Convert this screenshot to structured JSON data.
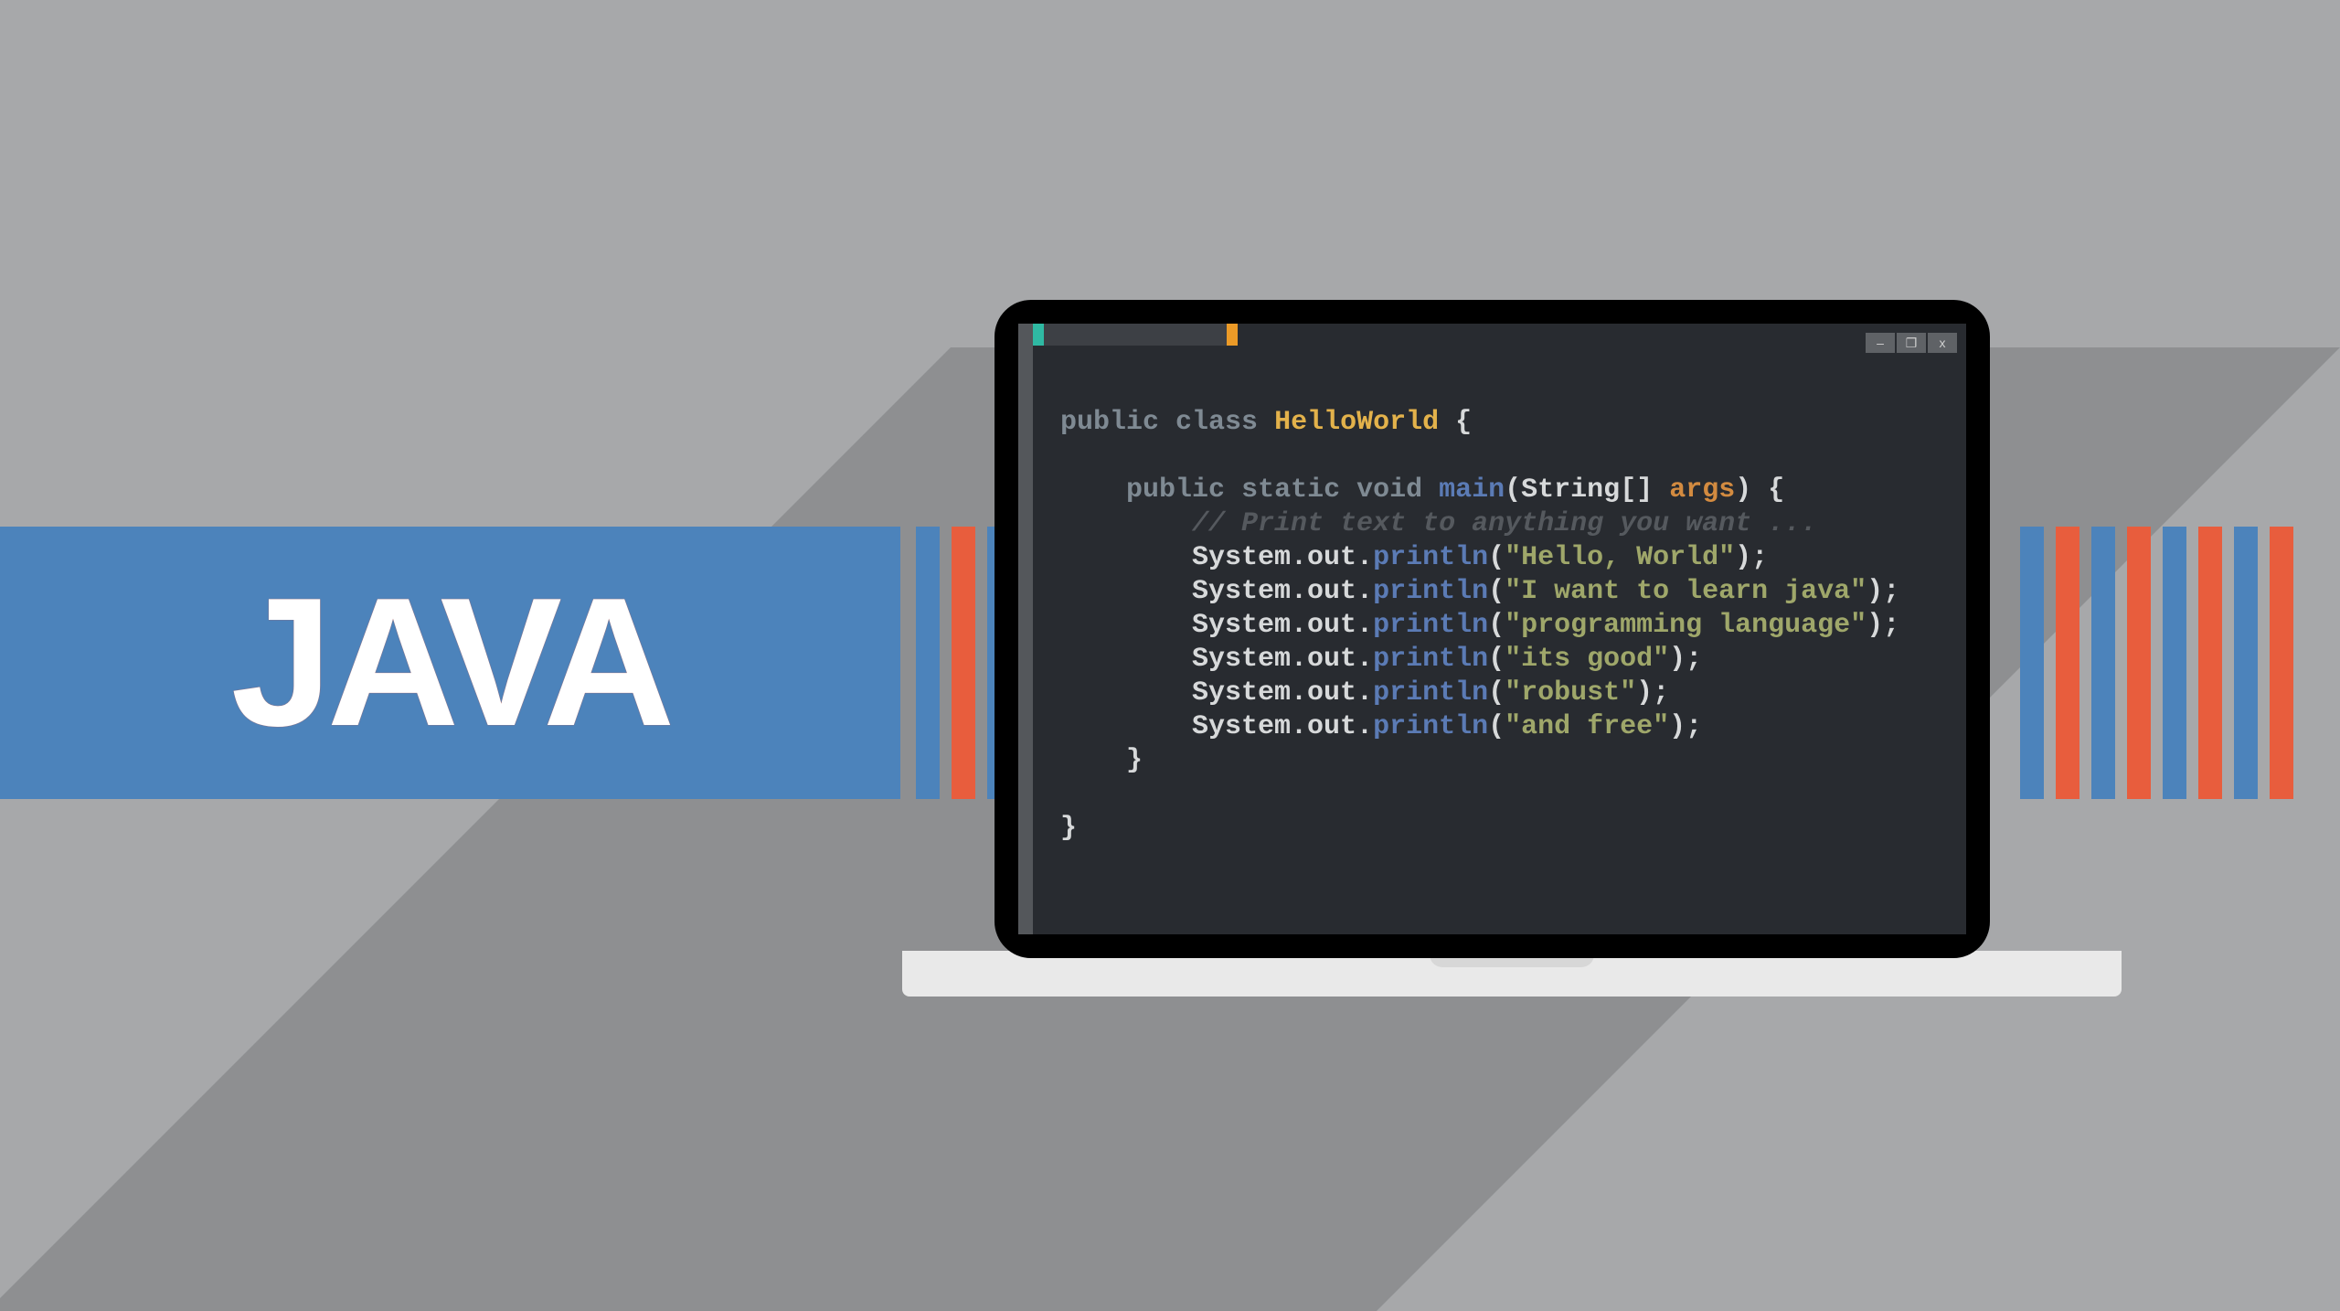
{
  "title": "JAVA",
  "window_controls": {
    "minimize_glyph": "–",
    "maximize_glyph": "❐",
    "close_glyph": "x"
  },
  "code": {
    "kw_public": "public",
    "kw_class": "class",
    "class_name": "HelloWorld",
    "brace_open": "{",
    "brace_close": "}",
    "kw_static": "static",
    "kw_void": "void",
    "fn_main": "main",
    "paren_open": "(",
    "paren_close": ")",
    "type_string_arr": "String[]",
    "param_args": "args",
    "comment": "// Print text to anything you want ...",
    "sysout_prefix": "System.out.",
    "fn_println": "println",
    "semi": ";",
    "strings": [
      "\"Hello, World\"",
      "\"I want to learn java\"",
      "\"programming language\"",
      "\"its good\"",
      "\"robust\"",
      "\"and free\""
    ]
  },
  "stripes": {
    "left": [
      "blue",
      "orange",
      "blue"
    ],
    "right": [
      "blue",
      "orange",
      "blue",
      "orange",
      "blue",
      "orange",
      "blue",
      "orange"
    ]
  }
}
